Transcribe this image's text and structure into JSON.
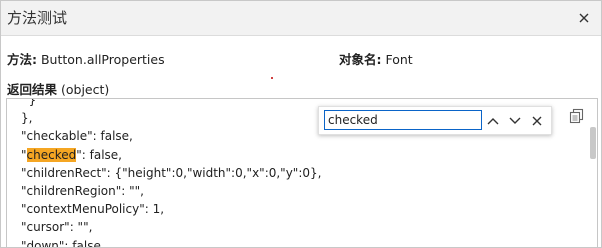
{
  "window": {
    "title": "方法测试",
    "close_icon": "close-icon"
  },
  "info": {
    "method_label": "方法:",
    "method_value": "Button.allProperties",
    "object_label": "对象名:",
    "object_value": "Font",
    "result_label": "返回结果",
    "result_type": "(object)"
  },
  "code_lines": {
    "l0": "  }",
    "l1": "},",
    "l2": "\"checkable\": false,",
    "l3_pre": "\"",
    "l3_hl": "checked",
    "l3_post": "\": false,",
    "l4": "\"childrenRect\": {\"height\":0,\"width\":0,\"x\":0,\"y\":0},",
    "l5": "\"childrenRegion\": \"\",",
    "l6": "\"contextMenuPolicy\": 1,",
    "l7": "\"cursor\": \"\",",
    "l8": "\"down\": false,"
  },
  "find": {
    "value": "checked",
    "prev_icon": "chevron-up-icon",
    "next_icon": "chevron-down-icon",
    "close_icon": "close-icon"
  },
  "copy_icon": "copy-icon",
  "colors": {
    "highlight": "#f5a623",
    "input_border": "#0a64c8"
  }
}
